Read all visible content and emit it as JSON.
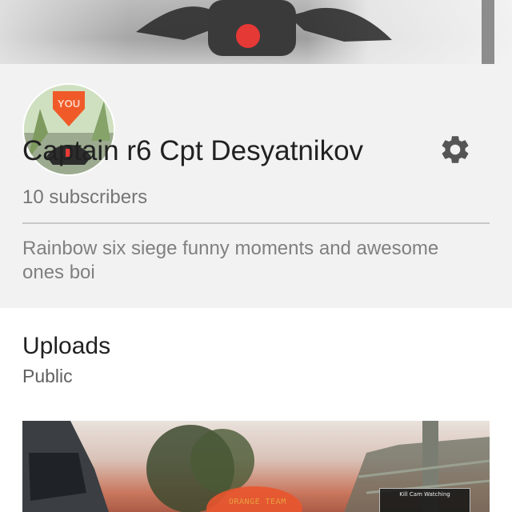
{
  "channel": {
    "title": "Captain r6 Cpt Desyatnikov",
    "subscribers": "10 subscribers",
    "description": "Rainbow six siege funny moments and awesome ones boi",
    "avatar_text": "YOU"
  },
  "uploads": {
    "title": "Uploads",
    "visibility": "Public",
    "video": {
      "team_label": "ORANGE TEAM",
      "killcam_label": "Kill Cam Watching"
    }
  },
  "icons": {
    "settings": "gear-icon"
  },
  "colors": {
    "title_text": "#212121",
    "secondary_text": "#757575",
    "profile_bg": "#f2f2f2",
    "uploads_bg": "#ffffff",
    "gear": "#555555",
    "avatar_marker": "#f05a28"
  }
}
